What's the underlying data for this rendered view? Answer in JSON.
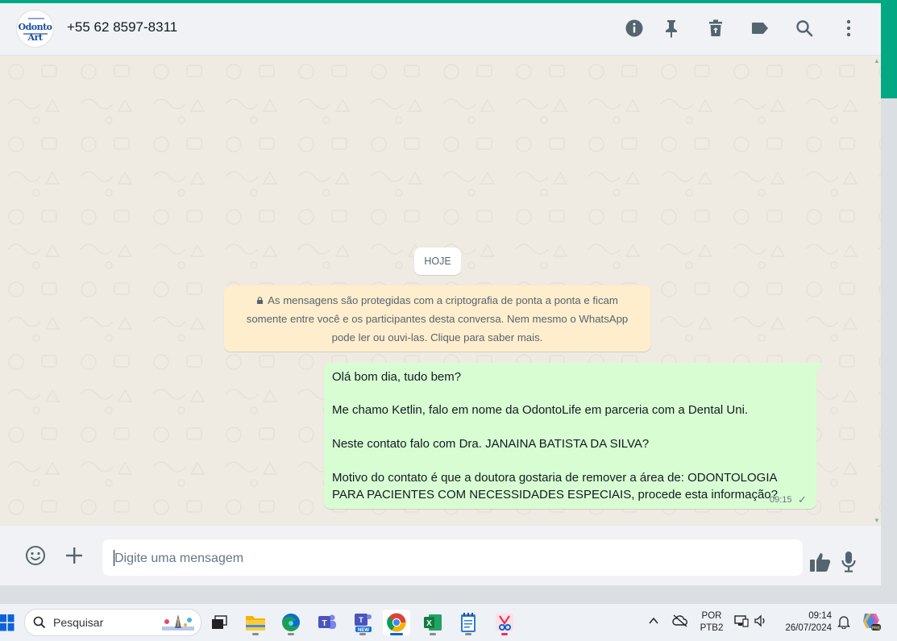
{
  "app": {
    "accent_color": "#00a884",
    "bubble_color": "#d9fdd3",
    "notice_color": "#ffeecd"
  },
  "header": {
    "avatar_text": "Odonto Art",
    "contact_name": "+55 62 8597-8311",
    "icons": [
      "info-icon",
      "pin-icon",
      "delete-icon",
      "label-icon",
      "search-icon",
      "menu-icon"
    ]
  },
  "chat": {
    "day_label": "HOJE",
    "e2e_notice": {
      "line1": "As mensagens são protegidas com a criptografia de ponta a ponta e ficam",
      "line2": "somente entre você e os participantes desta conversa. Nem mesmo o WhatsApp",
      "line3": "pode ler ou ouvi-las. Clique para saber mais."
    },
    "message": {
      "lines": [
        "Olá bom dia, tudo bem?",
        "Me chamo Ketlin, falo em nome da OdontoLife em parceria com a Dental Uni.",
        "Neste contato falo com Dra. JANAINA BATISTA DA SILVA?",
        "Motivo do contato é que a doutora gostaria de remover a área de: ODONTOLOGIA",
        "PARA PACIENTES COM NECESSIDADES ESPECIAIS, procede esta informação?"
      ],
      "time": "09:15",
      "status_glyph": "✓"
    }
  },
  "footer": {
    "input_placeholder": "Digite uma mensagem",
    "icons": [
      "emoji-icon",
      "attach-plus-icon",
      "thumbs-up-icon",
      "microphone-icon"
    ]
  },
  "taskbar": {
    "search_label": "Pesquisar",
    "apps": [
      "start",
      "task-view",
      "file-explorer",
      "edge",
      "teams",
      "teams-new",
      "chrome",
      "excel",
      "notepad",
      "snipping-tool"
    ],
    "lang_top": "POR",
    "lang_bottom": "PTB2",
    "time": "09:14",
    "date": "26/07/2024"
  }
}
